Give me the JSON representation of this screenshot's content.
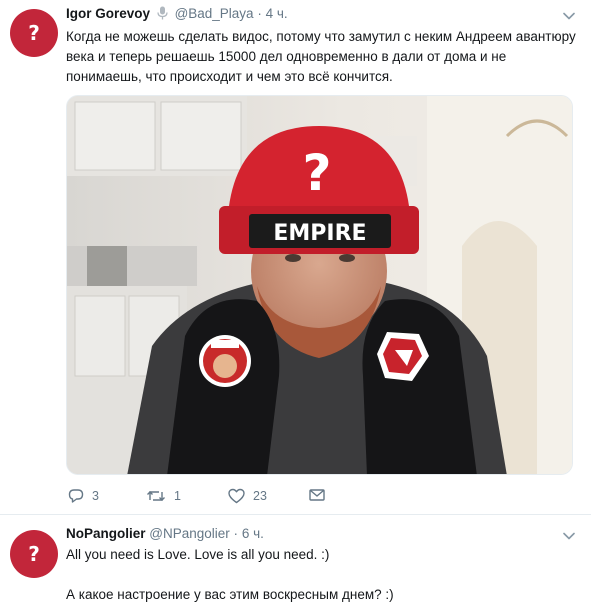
{
  "tweets": [
    {
      "avatar_glyph": "?",
      "fullname": "Igor Gorevoy",
      "handle": "@Bad_Playa",
      "separator": "·",
      "time": "4 ч.",
      "text": "Когда не можешь сделать видос, потому что замутил с неким Андреем авантюру века и теперь решаешь 15000 дел одновременно  в дали от дома и не понимаешь, что происходит и чем это всё кончится.",
      "hat_logo_text": "EMPIRE",
      "hat_question": "?",
      "actions": {
        "reply_count": "3",
        "retweet_count": "1",
        "like_count": "23"
      }
    },
    {
      "avatar_glyph": "?",
      "fullname": "NoPangolier",
      "handle": "@NPangolier",
      "separator": "·",
      "time": "6 ч.",
      "text_line_1": "All you need is Love. Love is all you need. :)",
      "text_line_2": "А какое настроение у вас этим воскресным днем? :)"
    }
  ],
  "colors": {
    "avatar": "#c2263a",
    "hat": "#d4232f",
    "muted": "#657786",
    "text": "#14171a"
  },
  "icons": [
    "microphone-icon",
    "chevron-down-icon",
    "reply-icon",
    "retweet-icon",
    "heart-icon",
    "envelope-icon"
  ]
}
